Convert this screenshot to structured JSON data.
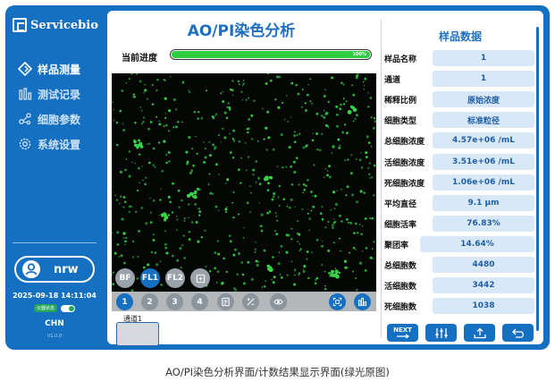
{
  "brand": {
    "name": "Servicebio"
  },
  "nav": {
    "items": [
      {
        "label": "样品测量",
        "icon": "diamond-icon",
        "active": true
      },
      {
        "label": "测试记录",
        "icon": "bar-chart-icon",
        "active": false
      },
      {
        "label": "细胞参数",
        "icon": "network-icon",
        "active": false
      },
      {
        "label": "系统设置",
        "icon": "gear-icon",
        "active": false
      }
    ]
  },
  "user": {
    "name": "nrw",
    "icon": "user-icon"
  },
  "status": {
    "datetime": "2025-09-18 14:11:04",
    "toggle_label": "仪器状态",
    "toggle_on": true,
    "language": "CHN",
    "version": "V1.0.0"
  },
  "main": {
    "title": "AO/PI染色分析",
    "progress": {
      "label": "当前进度",
      "percent_text": "100%",
      "value": 1.0
    },
    "channels": [
      "BF",
      "FL1",
      "FL2"
    ],
    "active_channel": "FL1",
    "fields": [
      "1",
      "2",
      "3",
      "4"
    ],
    "active_field": "1",
    "thumbnail_label": "通道1"
  },
  "sample": {
    "title": "样品数据",
    "rows": [
      {
        "label": "样品名称",
        "value": "1"
      },
      {
        "label": "通道",
        "value": "1"
      },
      {
        "label": "稀释比例",
        "value": "原始浓度"
      },
      {
        "label": "细胞类型",
        "value": "标准粒径"
      },
      {
        "label": "总细胞浓度",
        "value": "4.57e+06 /mL"
      },
      {
        "label": "活细胞浓度",
        "value": "3.51e+06 /mL"
      },
      {
        "label": "死细胞浓度",
        "value": "1.06e+06 /mL"
      },
      {
        "label": "平均直径",
        "value": "9.1 μm"
      },
      {
        "label": "细胞活率",
        "value": "76.83%"
      },
      {
        "label": "聚团率",
        "value": "14.64%"
      },
      {
        "label": "总细胞数",
        "value": "4480"
      },
      {
        "label": "活细胞数",
        "value": "3442"
      },
      {
        "label": "死细胞数",
        "value": "1038"
      }
    ]
  },
  "actions": {
    "next": "NEXT",
    "buttons": [
      "next-icon",
      "adjust-icon",
      "upload-icon",
      "back-icon"
    ]
  },
  "caption": "AO/PI染色分析界面/计数结果显示界面(绿光原图)",
  "colors": {
    "primary": "#1670c2",
    "progress": "#2ecc40",
    "cell": "#39d34a"
  }
}
